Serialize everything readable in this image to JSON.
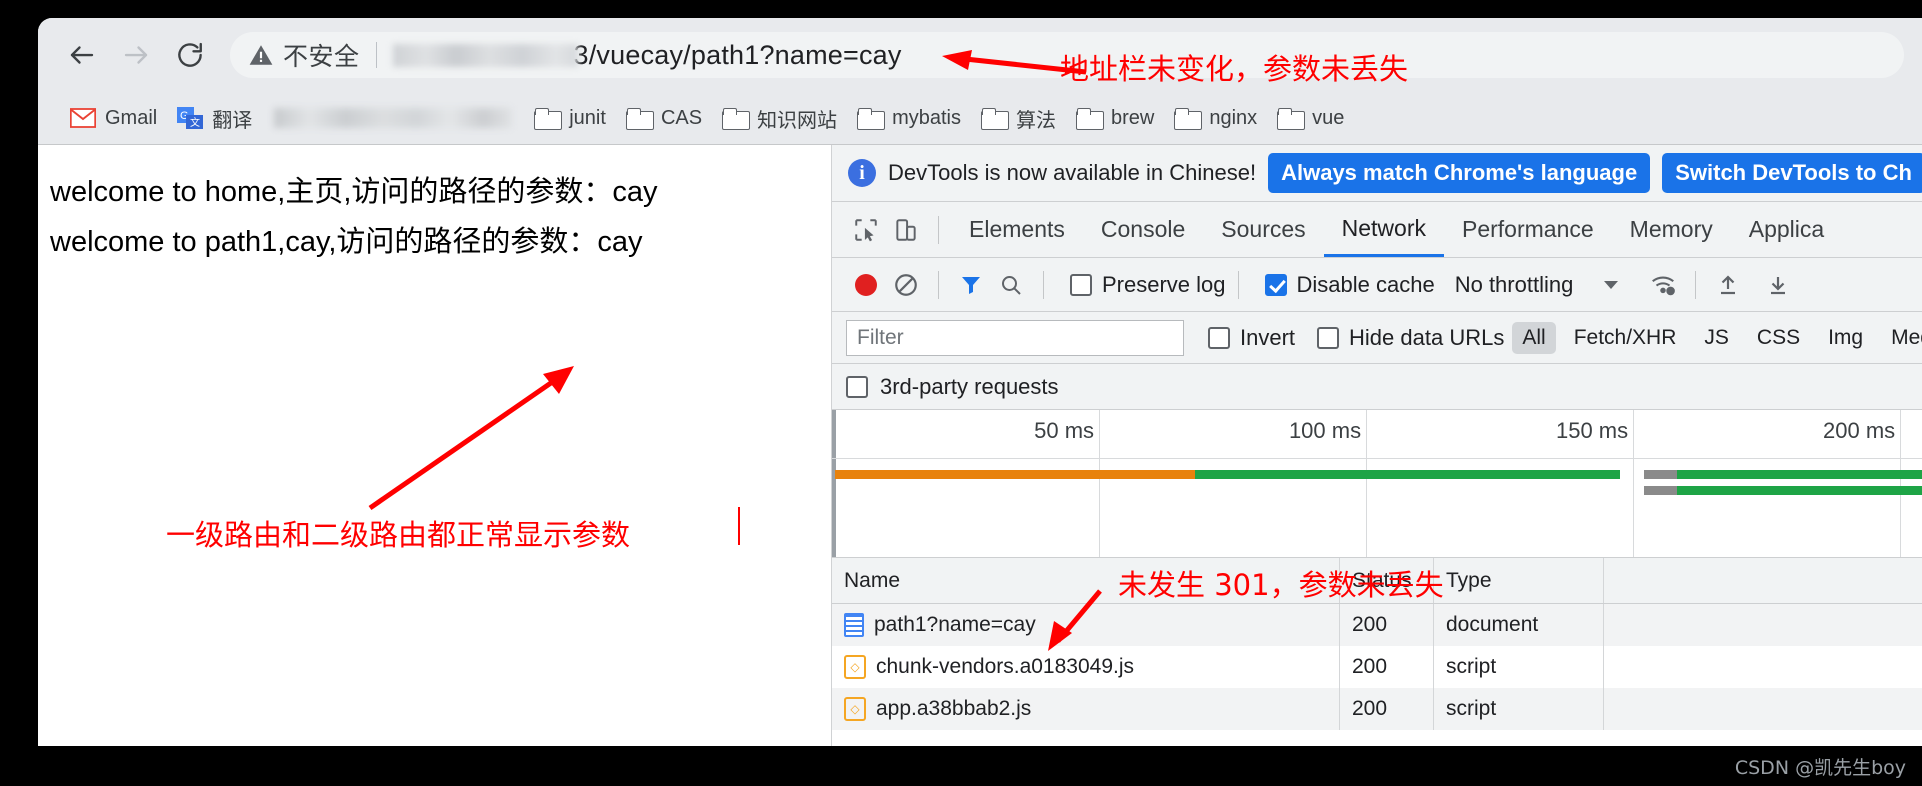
{
  "browser": {
    "nav": {
      "back_label": "Back",
      "forward_label": "Forward",
      "reload_label": "Reload"
    },
    "omnibox": {
      "security_label": "不安全",
      "security_icon": "warning-triangle-icon",
      "url_visible": "3/vuecay/path1?name=cay",
      "url_redacted": true
    },
    "bookmarks": [
      {
        "label": "Gmail",
        "icon": "gmail-icon"
      },
      {
        "label": "翻译",
        "icon": "google-translate-icon"
      },
      {
        "label": "",
        "icon": "redacted-bookmark",
        "redacted": true
      },
      {
        "label": "junit",
        "icon": "folder-icon"
      },
      {
        "label": "CAS",
        "icon": "folder-icon"
      },
      {
        "label": "知识网站",
        "icon": "folder-icon"
      },
      {
        "label": "mybatis",
        "icon": "folder-icon"
      },
      {
        "label": "算法",
        "icon": "folder-icon"
      },
      {
        "label": "brew",
        "icon": "folder-icon"
      },
      {
        "label": "nginx",
        "icon": "folder-icon"
      },
      {
        "label": "vue",
        "icon": "folder-icon"
      }
    ]
  },
  "page": {
    "line1": "welcome to home,主页,访问的路径的参数：cay",
    "line2": "welcome to path1,cay,访问的路径的参数：cay"
  },
  "annotations": {
    "address_bar": "地址栏未变化，参数未丢失",
    "routes": "一级路由和二级路由都正常显示参数",
    "no_301": "未发生 301，参数未丢失",
    "color": "#ff0000"
  },
  "devtools": {
    "banner": {
      "icon": "info-icon",
      "message": "DevTools is now available in Chinese!",
      "btn_always_match": "Always match Chrome's language",
      "btn_switch": "Switch DevTools to Ch"
    },
    "tool_icons": [
      {
        "name": "inspect-element-icon"
      },
      {
        "name": "device-toolbar-icon"
      }
    ],
    "tabs": [
      {
        "label": "Elements",
        "active": false
      },
      {
        "label": "Console",
        "active": false
      },
      {
        "label": "Sources",
        "active": false
      },
      {
        "label": "Network",
        "active": true
      },
      {
        "label": "Performance",
        "active": false
      },
      {
        "label": "Memory",
        "active": false
      },
      {
        "label": "Applica",
        "active": false
      }
    ],
    "network_toolbar": {
      "record_icon": "record-stop-icon",
      "clear_icon": "clear-icon",
      "filter_icon": "filter-funnel-icon",
      "search_icon": "search-icon",
      "preserve_log_label": "Preserve log",
      "preserve_log_checked": false,
      "disable_cache_label": "Disable cache",
      "disable_cache_checked": true,
      "throttling_value": "No throttling",
      "throttling_caret": "chevron-down-icon",
      "network_conditions_icon": "wifi-settings-icon",
      "import_icon": "upload-arrow-icon",
      "export_icon": "download-arrow-icon"
    },
    "filter_bar": {
      "filter_placeholder": "Filter",
      "filter_value": "",
      "invert_label": "Invert",
      "invert_checked": false,
      "hide_data_urls_label": "Hide data URLs",
      "hide_data_urls_checked": false,
      "types": [
        {
          "label": "All",
          "selected": true
        },
        {
          "label": "Fetch/XHR",
          "selected": false
        },
        {
          "label": "JS",
          "selected": false
        },
        {
          "label": "CSS",
          "selected": false
        },
        {
          "label": "Img",
          "selected": false
        },
        {
          "label": "Medi",
          "selected": false
        }
      ],
      "third_party_label": "3rd-party requests",
      "third_party_checked": false
    },
    "overview": {
      "ticks": [
        "50 ms",
        "100 ms",
        "150 ms",
        "200 ms"
      ],
      "bars": [
        {
          "color": "#e8820c",
          "start_pct": 0.3,
          "width_pct": 33.0,
          "row": 0
        },
        {
          "color": "#1ea446",
          "start_pct": 33.3,
          "width_pct": 39.0,
          "row": 0
        },
        {
          "color": "#8a8a8a",
          "start_pct": 74.5,
          "width_pct": 3.0,
          "row": 0
        },
        {
          "color": "#1ea446",
          "start_pct": 77.5,
          "width_pct": 22.5,
          "row": 0
        },
        {
          "color": "#8a8a8a",
          "start_pct": 74.5,
          "width_pct": 3.0,
          "row": 1
        },
        {
          "color": "#1ea446",
          "start_pct": 77.5,
          "width_pct": 22.5,
          "row": 1
        }
      ]
    },
    "requests": {
      "columns": [
        "Name",
        "Status",
        "Type"
      ],
      "rows": [
        {
          "name": "path1?name=cay",
          "status": "200",
          "type": "document",
          "icon": "document-icon"
        },
        {
          "name": "chunk-vendors.a0183049.js",
          "status": "200",
          "type": "script",
          "icon": "script-icon"
        },
        {
          "name": "app.a38bbab2.js",
          "status": "200",
          "type": "script",
          "icon": "script-icon"
        }
      ]
    }
  },
  "watermark": "CSDN @凯先生boy"
}
